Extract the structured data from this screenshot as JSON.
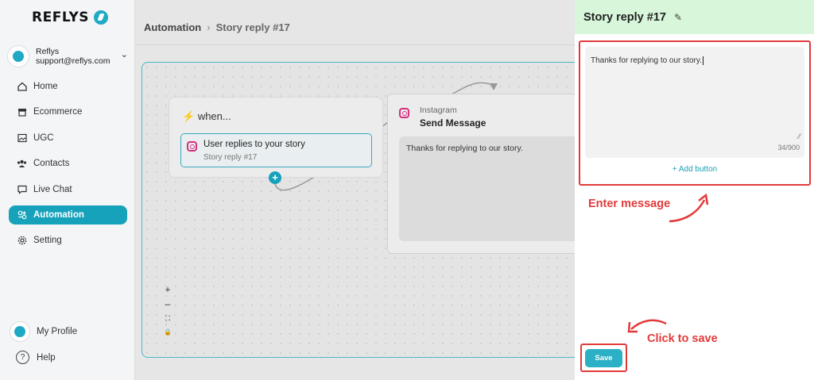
{
  "brand": {
    "name": "REFLYS"
  },
  "account": {
    "name": "Reflys",
    "email": "support@reflys.com"
  },
  "nav": [
    {
      "label": "Home",
      "icon": "home-icon"
    },
    {
      "label": "Ecommerce",
      "icon": "store-icon"
    },
    {
      "label": "UGC",
      "icon": "image-icon"
    },
    {
      "label": "Contacts",
      "icon": "people-icon"
    },
    {
      "label": "Live Chat",
      "icon": "chat-icon"
    },
    {
      "label": "Automation",
      "icon": "automation-icon",
      "active": true
    },
    {
      "label": "Setting",
      "icon": "gear-icon"
    }
  ],
  "footer": {
    "profile": "My Profile",
    "help": "Help"
  },
  "breadcrumb": {
    "root": "Automation",
    "current": "Story reply #17"
  },
  "flow": {
    "when_label": "when...",
    "trigger": {
      "title": "User replies to your story",
      "subtitle": "Story reply #17"
    },
    "action": {
      "platform": "Instagram",
      "title": "Send Message",
      "message": "Thanks for replying to our story."
    }
  },
  "zoom_controls": [
    "+",
    "–",
    "⛶",
    "🔒"
  ],
  "panel": {
    "title": "Story reply #17",
    "message": "Thanks for replying to our story.",
    "counter": "34/900",
    "add_button": "+ Add button",
    "save": "Save"
  },
  "annotations": {
    "enter_message": "Enter message",
    "click_to_save": "Click to save"
  },
  "colors": {
    "accent": "#17a2bb",
    "annotation": "#e23a3a",
    "panel_header": "#d7f6da"
  }
}
